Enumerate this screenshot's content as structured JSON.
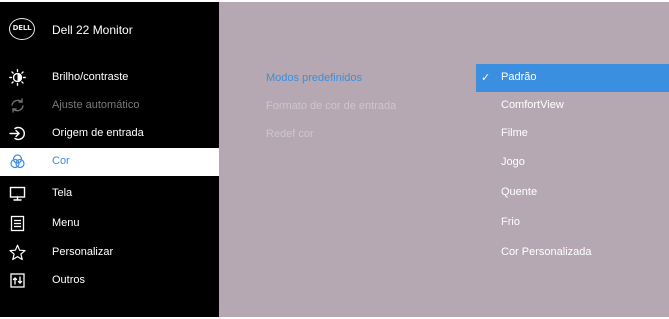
{
  "header": {
    "logo_text": "DELL",
    "model": "Dell 22 Monitor"
  },
  "menu": [
    {
      "label": "Brilho/contraste",
      "icon": "brightness-icon",
      "state": "normal"
    },
    {
      "label": "Ajuste automático",
      "icon": "auto-adjust-icon",
      "state": "disabled"
    },
    {
      "label": "Origem de entrada",
      "icon": "input-source-icon",
      "state": "normal"
    },
    {
      "label": "Cor",
      "icon": "color-icon",
      "state": "selected"
    },
    {
      "label": "Tela",
      "icon": "display-icon",
      "state": "normal"
    },
    {
      "label": "Menu",
      "icon": "menu-icon",
      "state": "normal"
    },
    {
      "label": "Personalizar",
      "icon": "star-icon",
      "state": "normal"
    },
    {
      "label": "Outros",
      "icon": "others-icon",
      "state": "normal"
    }
  ],
  "color_options": [
    {
      "label": "Modos predefinidos",
      "state": "active"
    },
    {
      "label": "Formato de cor de entrada",
      "state": "normal"
    },
    {
      "label": "Redef cor",
      "state": "normal"
    }
  ],
  "preset_modes": {
    "check_glyph": "✓",
    "selected": "Padrão",
    "items": [
      "Padrão",
      "ComfortView",
      "Filme",
      "Jogo",
      "Quente",
      "Frio",
      "Cor Personalizada"
    ]
  },
  "colors": {
    "sidebar_bg": "#000000",
    "content_bg": "#b5a8b2",
    "accent": "#3a8fe0",
    "selected_row": "#ffffff",
    "disabled_text": "#7a7a7a"
  }
}
